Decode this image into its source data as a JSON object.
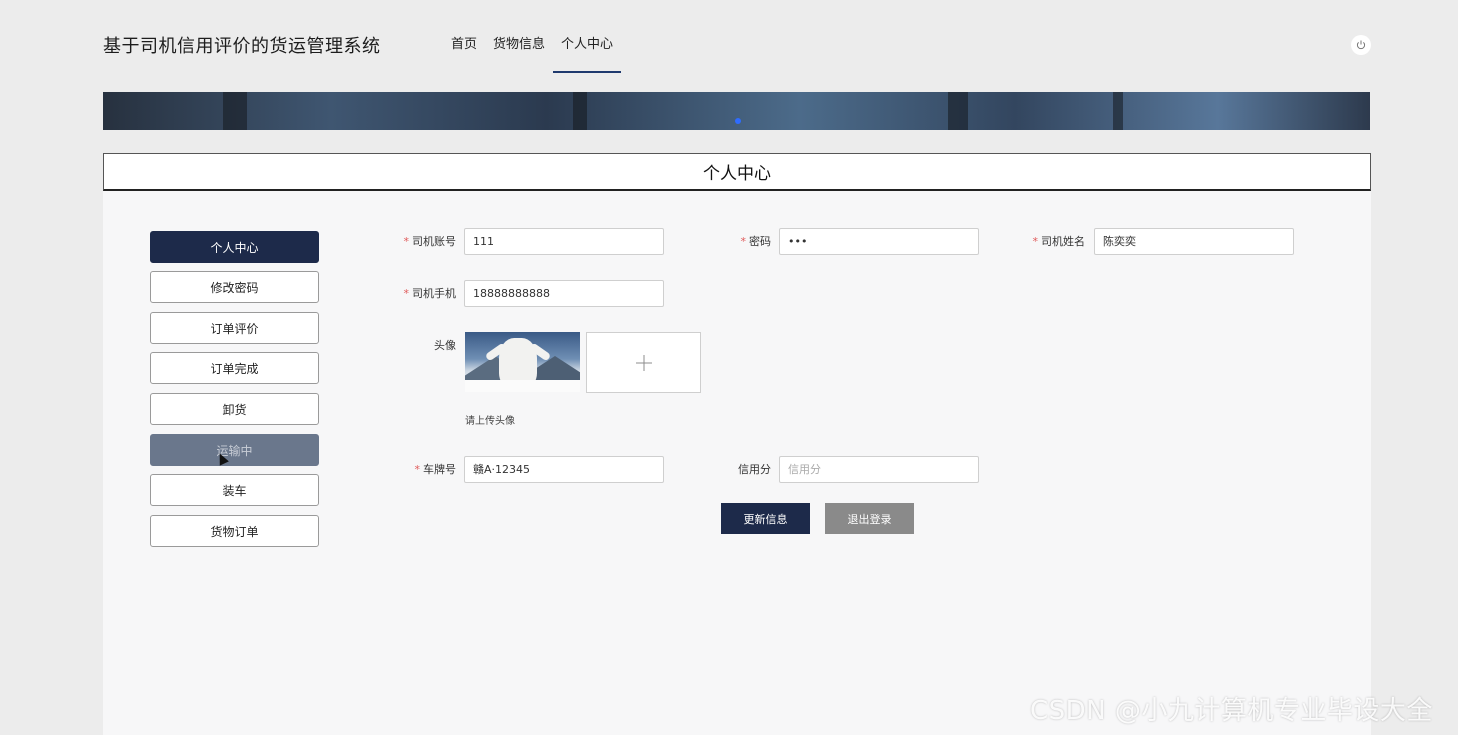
{
  "header": {
    "site_title": "基于司机信用评价的货运管理系统",
    "nav": [
      {
        "label": "首页",
        "active": false
      },
      {
        "label": "货物信息",
        "active": false
      },
      {
        "label": "个人中心",
        "active": true
      }
    ],
    "power_icon": "power-icon"
  },
  "section_title": "个人中心",
  "sidebar": {
    "items": [
      {
        "label": "个人中心",
        "state": "active"
      },
      {
        "label": "修改密码",
        "state": "normal"
      },
      {
        "label": "订单评价",
        "state": "normal"
      },
      {
        "label": "订单完成",
        "state": "normal"
      },
      {
        "label": "卸货",
        "state": "normal"
      },
      {
        "label": "运输中",
        "state": "hover"
      },
      {
        "label": "装车",
        "state": "normal"
      },
      {
        "label": "货物订单",
        "state": "normal"
      }
    ]
  },
  "form": {
    "account": {
      "label": "司机账号",
      "required": "*",
      "value": "111"
    },
    "password": {
      "label": "密码",
      "required": "*",
      "value": "•••"
    },
    "name": {
      "label": "司机姓名",
      "required": "*",
      "value": "陈奕奕"
    },
    "phone": {
      "label": "司机手机",
      "required": "*",
      "value": "18888888888"
    },
    "avatar": {
      "label": "头像",
      "upload_hint": "请上传头像",
      "add_icon": "plus-icon"
    },
    "plate": {
      "label": "车牌号",
      "required": "*",
      "value": "赣A·12345"
    },
    "credit": {
      "label": "信用分",
      "placeholder": "信用分"
    },
    "update_button": "更新信息",
    "logout_button": "退出登录"
  },
  "watermark": "CSDN @小九计算机专业毕设大全",
  "colors": {
    "primary": "#1d2a4a",
    "nav_active_underline": "#1f3a6e",
    "required": "#e05a5a",
    "logout_button": "#8a8a8a"
  }
}
